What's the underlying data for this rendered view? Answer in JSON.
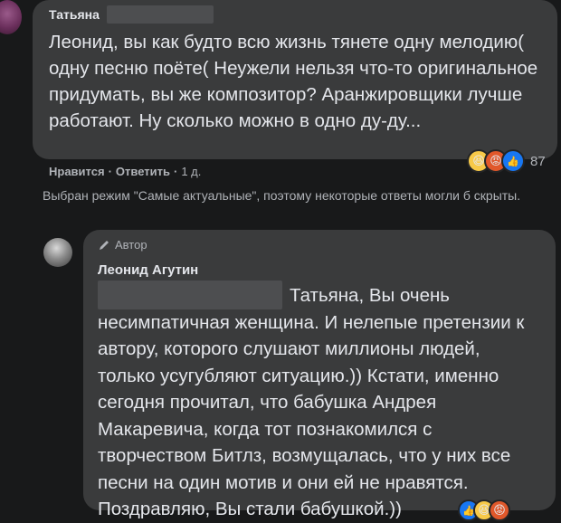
{
  "comment1": {
    "author": "Татьяна",
    "text": "Леонид, вы как будто всю жизнь тянете одну мелодию( одну песню поёте( Неужели нельзя что-то оригинальное придумать, вы же композитор? Аранжировщики лучше работают. Ну сколько можно в одно ду-ду...",
    "reaction_count": "87",
    "actions": {
      "like": "Нравится",
      "reply": "Ответить",
      "time": "1 д."
    }
  },
  "notice": "Выбран режим \"Самые актуальные\", поэтому некоторые ответы могли б скрыты.",
  "comment2": {
    "badge": "Автор",
    "author": "Леонид Агутин",
    "text": "Татьяна, Вы очень несимпатичная женщина. И нелепые претензии к автору, которого слушают миллионы людей, только усугубляют ситуацию.)) Кстати, именно сегодня прочитал, что бабушка Андрея Макаревича, когда тот познакомился с творчеством Битлз, возмущалась, что у них все песни на один мотив и они ей не нравятся. Поздравляю, Вы стали бабушкой.))"
  },
  "colors": {
    "background": "#18191a",
    "bubble": "#3a3b3c",
    "text": "#e4e6eb",
    "secondary": "#b0b3b8",
    "like_blue": "#1877f2"
  },
  "icons": [
    "haha-reaction-icon",
    "angry-reaction-icon",
    "like-reaction-icon",
    "pencil-icon"
  ]
}
